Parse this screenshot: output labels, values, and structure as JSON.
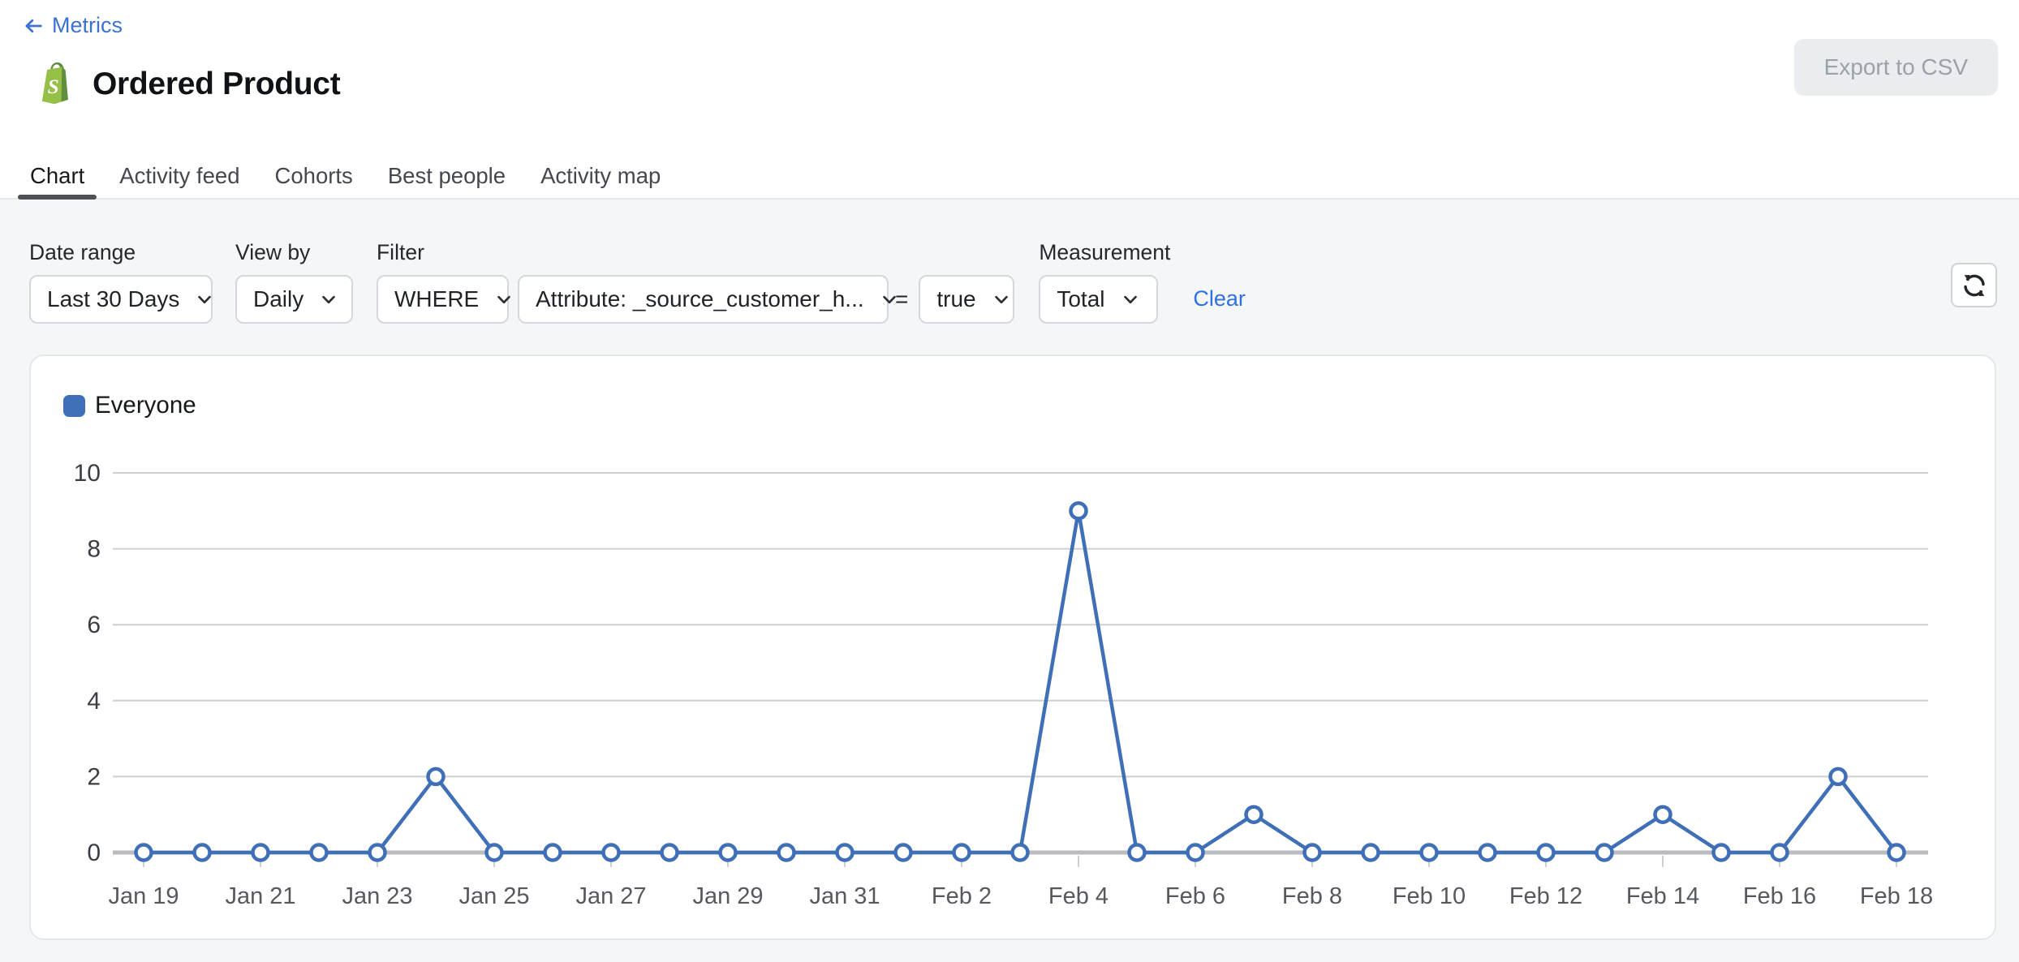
{
  "header": {
    "back_label": "Metrics",
    "title": "Ordered Product",
    "export_label": "Export to CSV"
  },
  "tabs": [
    {
      "label": "Chart",
      "active": true
    },
    {
      "label": "Activity feed",
      "active": false
    },
    {
      "label": "Cohorts",
      "active": false
    },
    {
      "label": "Best people",
      "active": false
    },
    {
      "label": "Activity map",
      "active": false
    }
  ],
  "filters": {
    "date_range": {
      "label": "Date range",
      "value": "Last 30 Days"
    },
    "view_by": {
      "label": "View by",
      "value": "Daily"
    },
    "filter": {
      "label": "Filter",
      "operator": "WHERE",
      "attribute": "Attribute: _source_customer_h...",
      "equals": "=",
      "value": "true"
    },
    "measurement": {
      "label": "Measurement",
      "value": "Total"
    },
    "clear_label": "Clear"
  },
  "icons": {
    "back": "back-arrow-icon",
    "shopify": "shopify-bag-icon",
    "chevron": "chevron-down-icon",
    "refresh": "refresh-sync-icon"
  },
  "chart_data": {
    "type": "line",
    "title": "",
    "xlabel": "",
    "ylabel": "",
    "x": [
      "Jan 19",
      "Jan 20",
      "Jan 21",
      "Jan 22",
      "Jan 23",
      "Jan 24",
      "Jan 25",
      "Jan 26",
      "Jan 27",
      "Jan 28",
      "Jan 29",
      "Jan 30",
      "Jan 31",
      "Feb 1",
      "Feb 2",
      "Feb 3",
      "Feb 4",
      "Feb 5",
      "Feb 6",
      "Feb 7",
      "Feb 8",
      "Feb 9",
      "Feb 10",
      "Feb 11",
      "Feb 12",
      "Feb 13",
      "Feb 14",
      "Feb 15",
      "Feb 16",
      "Feb 17",
      "Feb 18"
    ],
    "x_label_every": 2,
    "series": [
      {
        "name": "Everyone",
        "color": "#3f6fb6",
        "values": [
          0,
          0,
          0,
          0,
          0,
          2,
          0,
          0,
          0,
          0,
          0,
          0,
          0,
          0,
          0,
          0,
          9,
          0,
          0,
          1,
          0,
          0,
          0,
          0,
          0,
          0,
          1,
          0,
          0,
          2,
          0
        ]
      }
    ],
    "legend": [
      {
        "label": "Everyone",
        "color": "#3f6fb6"
      }
    ],
    "legend_position": "top-left",
    "yticks": [
      0,
      2,
      4,
      6,
      8,
      10
    ],
    "ylim": [
      0,
      10
    ],
    "grid": "horizontal",
    "markers": "hollow-circle"
  },
  "colors": {
    "accent_link": "#3b72cf",
    "clear_link": "#2e71e5",
    "series_blue": "#3f6fb6",
    "marker_fill": "#ffffff",
    "grid_line": "#cccfd3",
    "axis_zero_line": "#b8bbbf",
    "y_label": "#3a3e44",
    "x_label": "#55595f",
    "active_tab_underline": "#4d5156",
    "page_bg": "#f5f6f8",
    "export_button_bg": "#eaecef",
    "export_button_text": "#9ba1a9",
    "shopify_green": "#95BF47",
    "shopify_green_dark": "#5E8E3E"
  }
}
